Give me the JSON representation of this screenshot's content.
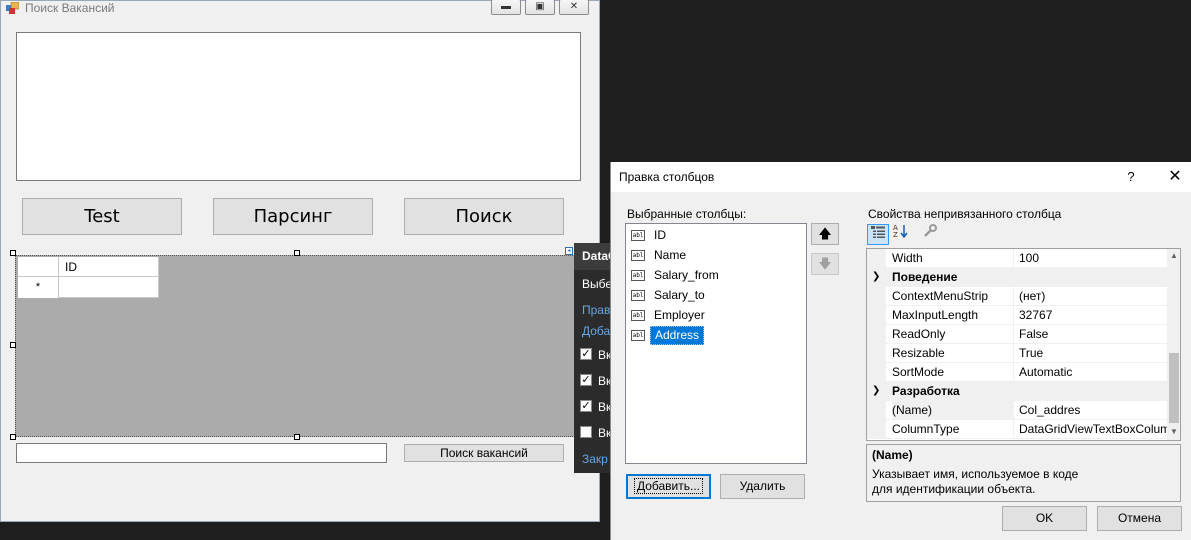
{
  "form": {
    "title": "Поиск Вакансий",
    "buttons": {
      "test": "Test",
      "parse": "Парсинг",
      "search": "Поиск"
    },
    "grid": {
      "header": "ID",
      "new_row_marker": "*"
    },
    "bottom_button": "Поиск вакансий",
    "window_controls": {
      "minimize": "▬",
      "maximize": "▣",
      "close": "✕"
    }
  },
  "tasks_panel": {
    "title": "DataGridView Tasks",
    "items": [
      "Выбе",
      "Прав",
      "Доба",
      "Вк",
      "Вк",
      "Вк",
      "Вк",
      "Закр"
    ],
    "checks": [
      true,
      true,
      true,
      false
    ]
  },
  "dialog": {
    "title": "Правка столбцов",
    "help": "?",
    "close": "✕",
    "selected_columns_label": "Выбранные столбцы:",
    "columns": [
      "ID",
      "Name",
      "Salary_from",
      "Salary_to",
      "Employer",
      "Address"
    ],
    "column_icon": "abl",
    "selected_column": "Address",
    "move_up": "🡅",
    "move_down": "🡇",
    "add_button": "Добавить...",
    "remove_button": "Удалить",
    "properties_label": "Свойства непривязанного столбца",
    "property_rows": [
      {
        "name": "Width",
        "value": "100"
      },
      {
        "category": "Поведение"
      },
      {
        "name": "ContextMenuStrip",
        "value": "(нет)"
      },
      {
        "name": "MaxInputLength",
        "value": "32767"
      },
      {
        "name": "ReadOnly",
        "value": "False"
      },
      {
        "name": "Resizable",
        "value": "True"
      },
      {
        "name": "SortMode",
        "value": "Automatic"
      },
      {
        "category": "Разработка"
      },
      {
        "name": "(Name)",
        "value": "Col_addres"
      },
      {
        "name": "ColumnType",
        "value": "DataGridViewTextBoxColumn"
      }
    ],
    "description_title": "(Name)",
    "description_text": "Указывает имя, используемое в коде для идентификации объекта.",
    "ok": "OK",
    "cancel": "Отмена"
  }
}
